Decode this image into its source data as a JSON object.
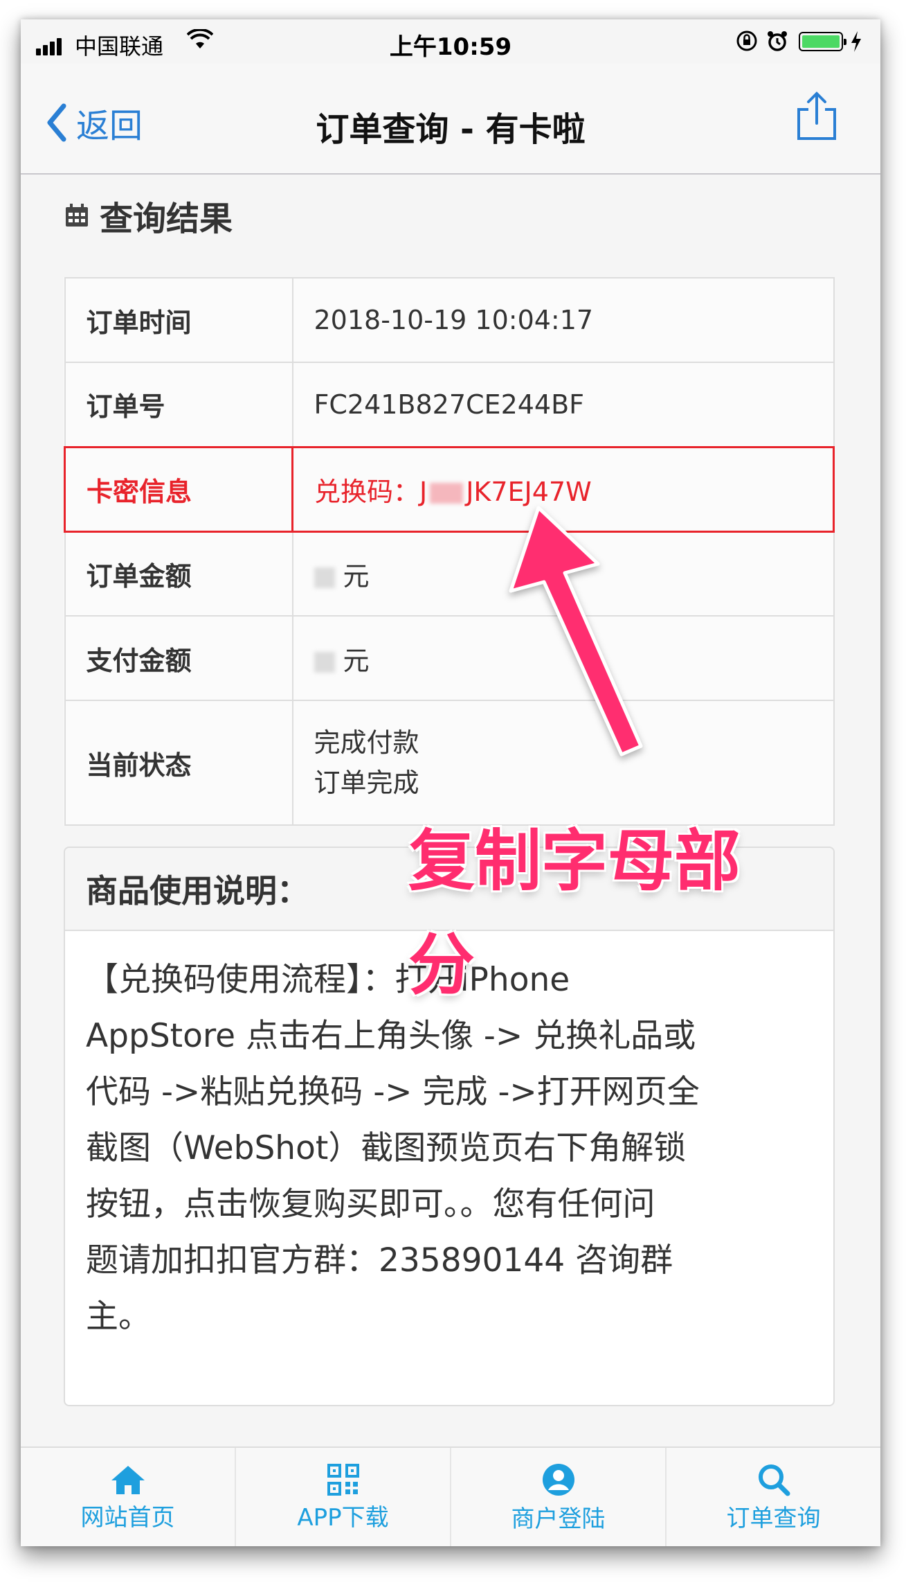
{
  "status_bar": {
    "carrier": "中国联通",
    "time": "上午10:59"
  },
  "nav": {
    "back_label": "返回",
    "title": "订单查询 - 有卡啦"
  },
  "section": {
    "title": "查询结果"
  },
  "order": {
    "time_label": "订单时间",
    "time_value": "2018-10-19 10:04:17",
    "number_label": "订单号",
    "number_value": "FC241B827CE244BF",
    "card_label": "卡密信息",
    "card_prefix": "兑换码：J",
    "card_suffix": "JK7EJ47W",
    "amount_label": "订单金额",
    "amount_unit": "元",
    "paid_label": "支付金额",
    "paid_unit": "元",
    "status_label": "当前状态",
    "status_line1": "完成付款",
    "status_line2": "订单完成"
  },
  "panel": {
    "title": "商品使用说明：",
    "body": "【兑换码使用流程】：打开iPhone\nAppStore 点击右上角头像 -> 兑换礼品或\n代码 ->粘贴兑换码 -> 完成 ->打开网页全\n截图（WebShot）截图预览页右下角解锁\n按钮，点击恢复购买即可。。您有任何问\n题请加扣扣官方群：235890144 咨询群\n主。"
  },
  "annotation": {
    "text": "复制字母部分",
    "color": "#ff2d6f"
  },
  "tabs": [
    {
      "label": "网站首页",
      "icon": "home-icon"
    },
    {
      "label": "APP下载",
      "icon": "qr-code-icon"
    },
    {
      "label": "商户登陆",
      "icon": "user-icon"
    },
    {
      "label": "订单查询",
      "icon": "search-icon"
    }
  ],
  "colors": {
    "accent": "#1e9fde",
    "highlight": "#e8232b",
    "battery": "#4cd964"
  }
}
